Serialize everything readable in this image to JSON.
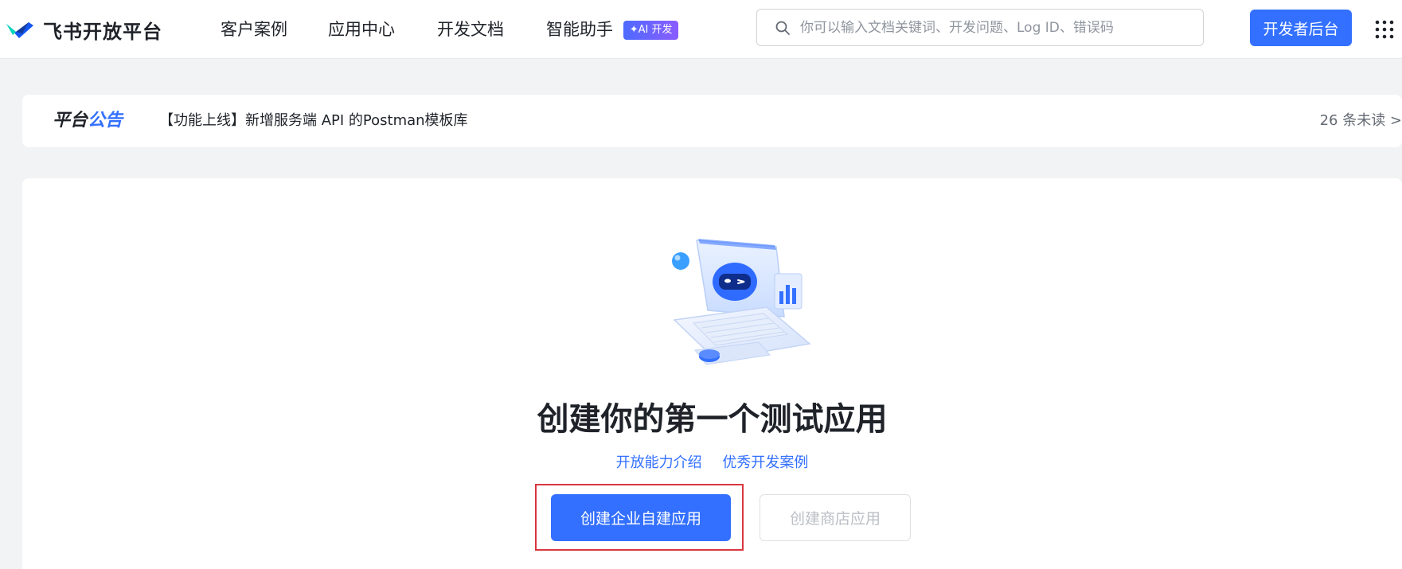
{
  "header": {
    "logo_text": "飞书开放平台",
    "nav": [
      {
        "label": "客户案例"
      },
      {
        "label": "应用中心"
      },
      {
        "label": "开发文档"
      },
      {
        "label": "智能助手",
        "badge": "✦AI 开发"
      }
    ],
    "search": {
      "placeholder": "你可以输入文档关键词、开发问题、Log ID、错误码",
      "value": ""
    },
    "dev_console_label": "开发者后台",
    "icons": {
      "logo": "feishu-logo-icon",
      "search": "search-icon",
      "apps": "grid-icon"
    }
  },
  "announcement": {
    "label_part1": "平台",
    "label_part2": "公告",
    "text": "【功能上线】新增服务端 API 的Postman模板库",
    "unread": "26 条未读 >"
  },
  "main": {
    "title": "创建你的第一个测试应用",
    "links": [
      "开放能力介绍",
      "优秀开发案例"
    ],
    "primary_button": "创建企业自建应用",
    "secondary_button": "创建商店应用",
    "illustration": "laptop-robot-illustration"
  },
  "colors": {
    "accent": "#3370ff",
    "highlight_border": "#d9363e",
    "background": "#f2f3f5"
  }
}
